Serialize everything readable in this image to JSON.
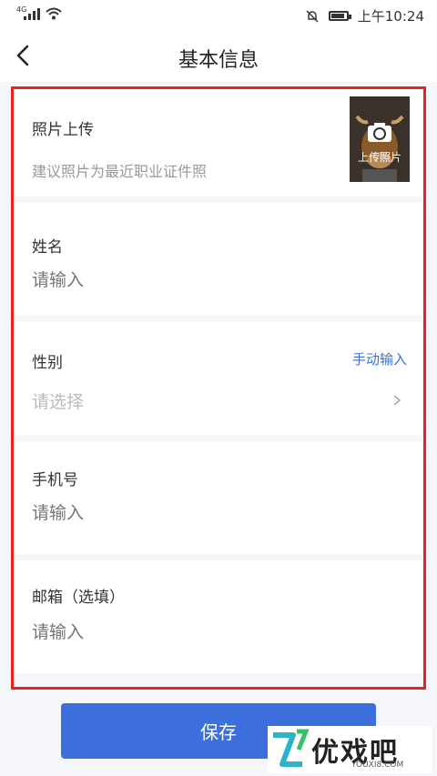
{
  "status_bar": {
    "network": "4G",
    "time": "上午10:24"
  },
  "header": {
    "title": "基本信息"
  },
  "photo_section": {
    "label": "照片上传",
    "hint": "建议照片为最近职业证件照",
    "upload_label": "上传照片"
  },
  "name_field": {
    "label": "姓名",
    "placeholder": "请输入"
  },
  "gender_field": {
    "label": "性别",
    "manual_label": "手动输入",
    "placeholder": "请选择"
  },
  "phone_field": {
    "label": "手机号",
    "placeholder": "请输入"
  },
  "email_field": {
    "label": "邮箱（选填）",
    "placeholder": "请输入"
  },
  "save_button": {
    "label": "保存"
  },
  "watermark": {
    "text": "优戏吧",
    "sub": "YOUXI8.COM"
  },
  "colors": {
    "accent": "#3d6fdc",
    "link": "#3a6fd0",
    "highlight_border": "#e52420"
  }
}
